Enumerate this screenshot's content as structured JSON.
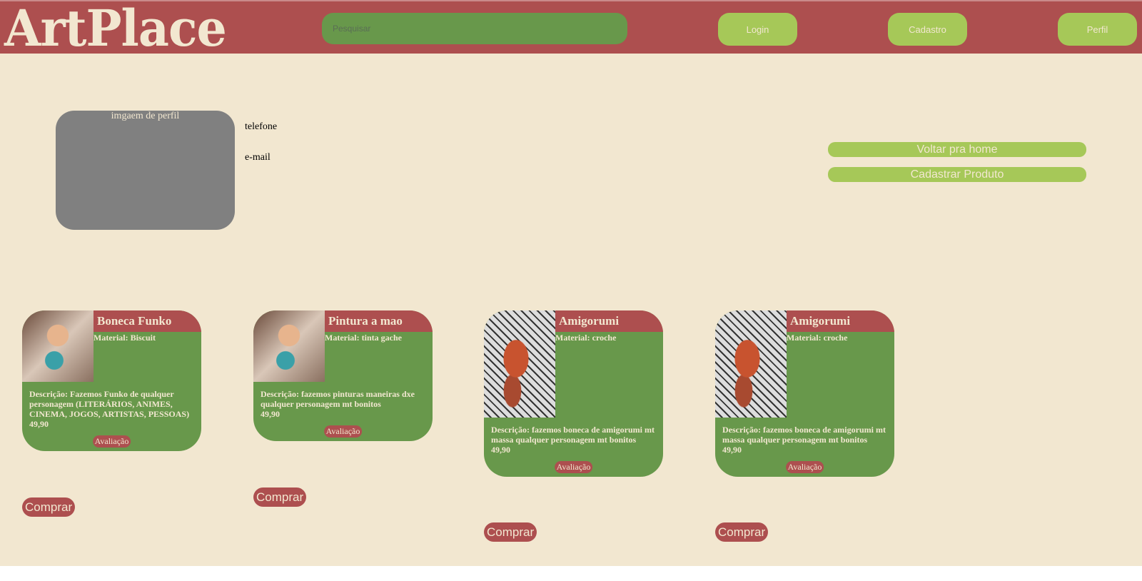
{
  "header": {
    "logo": "ArtPlace",
    "search_placeholder": "Pesquisar",
    "login": "Login",
    "cadastro": "Cadastro",
    "perfil": "Perfil"
  },
  "profile": {
    "image_label": "imgaem de perfil",
    "phone": "telefone",
    "email": "e-mail",
    "back_home": "Voltar pra home",
    "register_product": "Cadastrar Produto"
  },
  "products": [
    {
      "title": "Boneca Funko",
      "material": "Material: Biscuit",
      "description": "Descrição: Fazemos Funko de qualquer personagem (LITERÁRIOS, ANIMES, CINEMA, JOGOS, ARTISTAS, PESSOAS)",
      "price": "49,90",
      "rating": "Avaliação",
      "buy": "Comprar"
    },
    {
      "title": "Pintura a mao",
      "material": "Material: tinta gache",
      "description": "Descrição: fazemos pinturas maneiras dxe qualquer personagem mt bonitos",
      "price": "49,90",
      "rating": "Avaliação",
      "buy": "Comprar"
    },
    {
      "title": "Amigorumi",
      "material": "Material: croche",
      "description": "Descrição: fazemos boneca de amigorumi mt massa qualquer personagem mt bonitos",
      "price": "49,90",
      "rating": "Avaliação",
      "buy": "Comprar"
    },
    {
      "title": "Amigorumi",
      "material": "Material: croche",
      "description": "Descrição: fazemos boneca de amigorumi mt massa qualquer personagem mt bonitos",
      "price": "49,90",
      "rating": "Avaliação",
      "buy": "Comprar"
    }
  ]
}
